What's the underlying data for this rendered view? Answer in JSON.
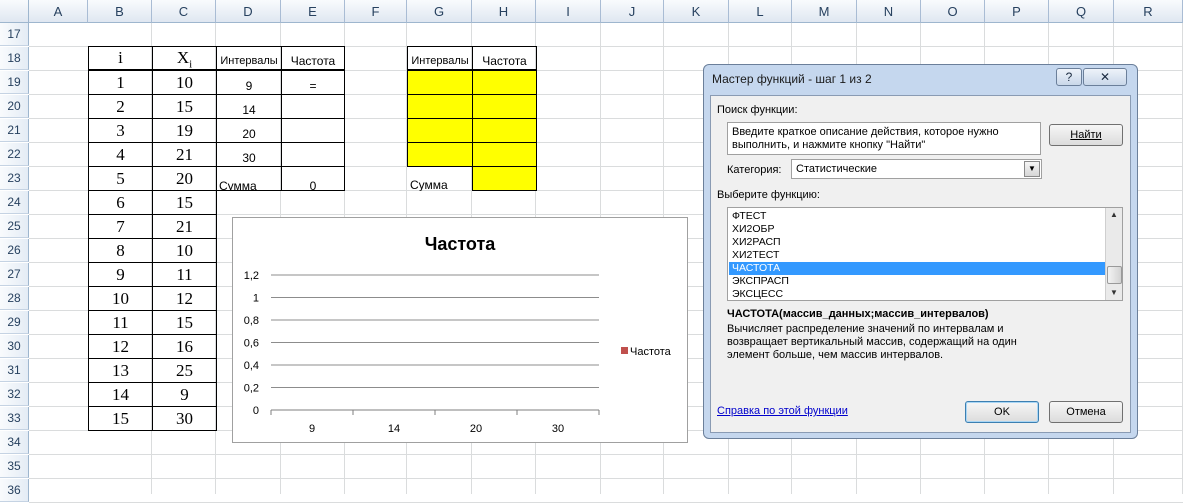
{
  "columns": [
    "A",
    "B",
    "C",
    "D",
    "E",
    "F",
    "G",
    "H",
    "I",
    "J",
    "K",
    "L",
    "M",
    "N",
    "O",
    "P",
    "Q",
    "R"
  ],
  "rows": [
    "17",
    "18",
    "19",
    "20",
    "21",
    "22",
    "23",
    "24",
    "25",
    "26",
    "27",
    "28",
    "29",
    "30",
    "31",
    "32",
    "33",
    "34",
    "35",
    "36"
  ],
  "table_b": {
    "header_i": "i",
    "header_x": "X",
    "header_x_sub": "i",
    "i_values": [
      "1",
      "2",
      "3",
      "4",
      "5",
      "6",
      "7",
      "8",
      "9",
      "10",
      "11",
      "12",
      "13",
      "14",
      "15"
    ],
    "x_values": [
      "10",
      "15",
      "19",
      "21",
      "20",
      "15",
      "21",
      "10",
      "11",
      "12",
      "15",
      "16",
      "25",
      "9",
      "30"
    ]
  },
  "table_d": {
    "header_intervals": "Интервалы",
    "header_freq": "Частота",
    "intervals": [
      "9",
      "14",
      "20",
      "30"
    ],
    "freq_first": "=",
    "sum_label": "Сумма",
    "sum_value": "0"
  },
  "table_g": {
    "header_intervals": "Интервалы",
    "header_freq": "Частота",
    "sum_label": "Сумма"
  },
  "chart_data": {
    "type": "bar",
    "title": "Частота",
    "categories": [
      "9",
      "14",
      "20",
      "30"
    ],
    "series": [
      {
        "name": "Частота",
        "values": [
          0,
          0,
          0,
          0
        ],
        "color": "#c0504d"
      }
    ],
    "ylim": [
      0,
      1.2
    ],
    "yticks": [
      "0",
      "0,2",
      "0,4",
      "0,6",
      "0,8",
      "1",
      "1,2"
    ],
    "grid": true,
    "legend": "right"
  },
  "dialog": {
    "title": "Мастер функций - шаг 1 из 2",
    "help_btn": "?",
    "close_btn": "✕",
    "search_label": "Поиск функции:",
    "search_text": "Введите краткое описание действия, которое нужно выполнить, и нажмите кнопку \"Найти\"",
    "find_btn": "Найти",
    "category_label": "Категория:",
    "category_value": "Статистические",
    "select_label": "Выберите функцию:",
    "functions": [
      "ФТЕСТ",
      "ХИ2ОБР",
      "ХИ2РАСП",
      "ХИ2ТЕСТ",
      "ЧАСТОТА",
      "ЭКСПРАСП",
      "ЭКСЦЕСС"
    ],
    "selected_function": "ЧАСТОТА",
    "signature": "ЧАСТОТА(массив_данных;массив_интервалов)",
    "description": "Вычисляет распределение значений по интервалам и возвращает вертикальный массив, содержащий на один элемент больше, чем массив интервалов.",
    "help_link": "Справка по этой функции",
    "ok_btn": "OK",
    "cancel_btn": "Отмена",
    "accent": "#3399ff"
  }
}
